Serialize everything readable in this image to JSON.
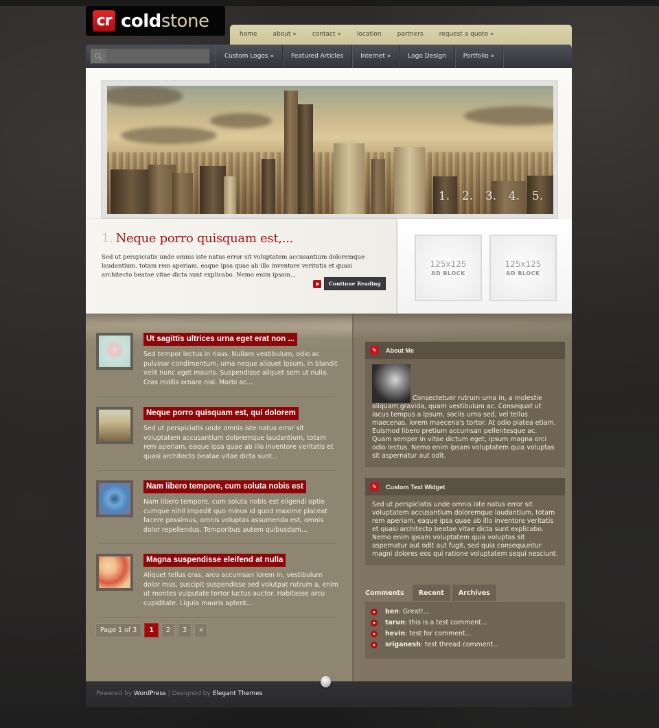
{
  "brand": {
    "badge": "cr",
    "name_part1": "cold",
    "name_part2": "stone",
    "accent": "#a3161a"
  },
  "top_nav": [
    {
      "label": "home"
    },
    {
      "label": "about »"
    },
    {
      "label": "contact »"
    },
    {
      "label": "location"
    },
    {
      "label": "partners"
    },
    {
      "label": "request a quote »"
    }
  ],
  "search": {
    "placeholder": "",
    "value": "",
    "icon": "search-icon"
  },
  "category_nav": [
    {
      "label": "Custom Logos »"
    },
    {
      "label": "Featured Articles"
    },
    {
      "label": "Internet »"
    },
    {
      "label": "Logo Design"
    },
    {
      "label": "Portfolio »"
    }
  ],
  "slider": {
    "pages": [
      "1.",
      "2.",
      "3.",
      "4.",
      "5."
    ]
  },
  "featured": {
    "number": "1.",
    "title": "Neque porro quisquam est,...",
    "excerpt": "Sed ut perspiciatis unde omnis iste natus error sit voluptatem accusantium doloremque laudantium, totam rem aperiam, eaque ipsa quae ab illo inventore veritatis et quasi architecto beatae vitae dicta sunt explicabo. Nemo enim ipsam...",
    "read_more": "Continue Reading"
  },
  "ads": [
    {
      "size": "125x125",
      "label": "AD BLOCK"
    },
    {
      "size": "125x125",
      "label": "AD BLOCK"
    }
  ],
  "posts": [
    {
      "title": "Ut sagittis ultrices urna eget erat non ...",
      "excerpt": "Sed tempor lectus in risus. Nullam vestibulum, odio ac pulvinar condimentum, urna neque aliquet ipsum, in blandit velit nunc eget mauris. Suspendisse aliquet sem ut nulla. Cras mollis ornare nisl. Morbi ac..."
    },
    {
      "title": "Neque porro quisquam est, qui dolorem",
      "excerpt": "Sed ut perspiciatis unde omnis iste natus error sit voluptatem accusantium doloremque laudantium, totam rem aperiam, eaque ipsa quae ab illo inventore veritatis et quasi architecto beatae vitae dicta sunt..."
    },
    {
      "title": "Nam libero tempore, cum soluta nobis est",
      "excerpt": "Nam libero tempore, cum soluta nobis est eligendi optio cumque nihil impedit quo minus id quod maxime placeat facere possimus, omnis voluptas assumenda est, omnis dolor repellendus. Temporibus autem quibusdam..."
    },
    {
      "title": "Magna suspendisse eleifend at nulla",
      "excerpt": "Aliquet tellus cras, arcu accumsan lorem in, vestibulum dolor mus, suscipit suspendisse sed volutpat rutrum a, enim ut montes vulputate tortor luctus auctor. Habitasse arcu cupiditate. Ligula mauris aptent..."
    }
  ],
  "pagination": {
    "status": "Page 1 of 3",
    "pages": [
      "1",
      "2",
      "3"
    ],
    "current": "1",
    "next": "»"
  },
  "widgets": {
    "about": {
      "title": "About Me",
      "text": "Consectetuer rutrum urna in, a molestie aliquam gravida, quam vestibulum ac. Consequat ut lacus tempus a ipsum, sociis urna sed, vel tellus maecenas, lorem maecena's tortor. At odio platea etiam. Euismod libero pretium accumsan pellentesque ac. Quam semper in vitae dictum eget, ipsum magna orci odio lectus. Nemo enim ipsam voluptatem quia voluptas sit aspernatur aut odit."
    },
    "custom_text": {
      "title": "Custom Text Widget",
      "text": "Sed ut perspiciatis unde omnis iste natus error sit voluptatem accusantium doloremque laudantium, totam rem aperiam, eaque ipsa quae ab illo inventore veritatis et quasi architecto beatae vitae dicta sunt explicabo. Nemo enim ipsam voluptatem quia voluptas sit aspernatur aut odit aut fugit, sed quia consequuntur magni dolores eos qui ratione voluptatem sequi nesciunt."
    }
  },
  "tabs": {
    "items": [
      {
        "label": "Comments"
      },
      {
        "label": "Recent"
      },
      {
        "label": "Archives"
      }
    ],
    "active": "Comments",
    "comments": [
      {
        "author": "ben",
        "text": ": Great!..."
      },
      {
        "author": "tarun",
        "text": ": this is a test comment..."
      },
      {
        "author": "hevin",
        "text": ": test for comment..."
      },
      {
        "author": "sriganesh",
        "text": ": test thread comment..."
      }
    ]
  },
  "footer": {
    "powered_by": "Powered by ",
    "wordpress": "WordPress",
    "separator": " | Designed by ",
    "designer": "Elegant Themes"
  }
}
